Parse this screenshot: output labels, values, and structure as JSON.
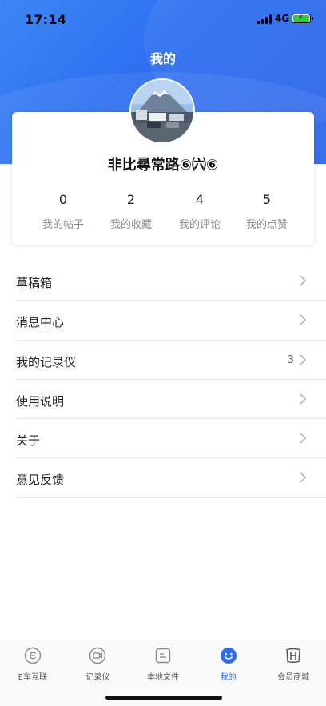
{
  "status_bar": {
    "time": "17:14",
    "network": "4G"
  },
  "header": {
    "title": "我的"
  },
  "profile": {
    "username": "非比尋常路⑥㈥⑥",
    "stats": [
      {
        "value": "0",
        "label": "我的帖子"
      },
      {
        "value": "2",
        "label": "我的收藏"
      },
      {
        "value": "4",
        "label": "我的评论"
      },
      {
        "value": "5",
        "label": "我的点赞"
      }
    ]
  },
  "menu": {
    "items": [
      {
        "label": "草稿箱",
        "count": ""
      },
      {
        "label": "消息中心",
        "count": ""
      },
      {
        "label": "我的记录仪",
        "count": "3"
      },
      {
        "label": "使用说明",
        "count": ""
      },
      {
        "label": "关于",
        "count": ""
      },
      {
        "label": "意见反馈",
        "count": ""
      }
    ]
  },
  "tabbar": {
    "active_index": 3,
    "tabs": [
      {
        "label": "E车互联",
        "icon": "e-connect-icon"
      },
      {
        "label": "记录仪",
        "icon": "dashcam-icon"
      },
      {
        "label": "本地文件",
        "icon": "local-file-icon"
      },
      {
        "label": "我的",
        "icon": "smiley-profile-icon"
      },
      {
        "label": "会员商城",
        "icon": "honda-logo-icon"
      }
    ]
  },
  "colors": {
    "accent": "#2d6ef0",
    "battery": "#2ecc40"
  }
}
